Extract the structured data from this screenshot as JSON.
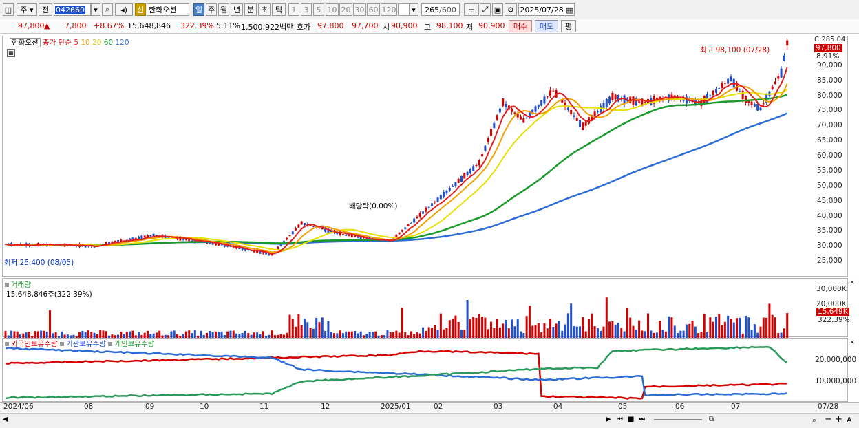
{
  "toolbar": {
    "period": "주",
    "prev_label": "전",
    "code": "042660",
    "stock_name": "한화오션",
    "credit_badge": "신",
    "tabs": [
      "일",
      "주",
      "월",
      "년",
      "분",
      "초",
      "틱"
    ],
    "active_tab": "일",
    "intervals": [
      "1",
      "3",
      "5",
      "10",
      "20",
      "30",
      "60",
      "120"
    ],
    "count": "265",
    "count_max": "/600",
    "date": "2025/07/28"
  },
  "quote": {
    "price": "97,800",
    "arrow": "▲",
    "change": "7,800",
    "change_pct": "+8.67%",
    "volume": "15,648,846",
    "volume_ratio": "322.39%",
    "turnover": "5.11%",
    "amount": "1,500,922백만",
    "hoga_label": "호가",
    "ask": "97,800",
    "bid": "97,700",
    "open_label": "시",
    "open": "90,900",
    "high_label": "고",
    "high": "98,100",
    "low_label": "저",
    "low": "90,900",
    "buy": "매수",
    "sell": "매도",
    "eval": "평"
  },
  "price_panel": {
    "legend_name": "한화오션",
    "ma_label": "종가 단순",
    "ma_periods": [
      {
        "p": "5",
        "color": "#e0201c"
      },
      {
        "p": "10",
        "color": "#f0a000"
      },
      {
        "p": "20",
        "color": "#e8e000"
      },
      {
        "p": "60",
        "color": "#1a9a2a"
      },
      {
        "p": "120",
        "color": "#2c6cd6"
      }
    ],
    "corner_label": "C:285.04",
    "last_price": "97,800",
    "last_pct": "8.91%",
    "high_note": "최고 98,100 (07/28)",
    "low_note": "최저 25,400 (08/05)",
    "dividend_note": "배당락(0.00%)",
    "y_ticks": [
      "90,000",
      "85,000",
      "80,000",
      "75,000",
      "70,000",
      "65,000",
      "60,000",
      "55,000",
      "50,000",
      "45,000",
      "40,000",
      "35,000",
      "30,000",
      "25,000"
    ]
  },
  "volume_panel": {
    "title": "거래량",
    "value": "15,648,846주(322.39%)",
    "y_ticks": [
      "30,000K",
      "20,000K"
    ],
    "last": "15,649K",
    "last_pct": "322.39%"
  },
  "holdings_panel": {
    "legend": [
      "외국인보유수량",
      "기관보유수량",
      "개인보유수량"
    ],
    "y_ticks": [
      "20,000,000",
      "10,000,000"
    ]
  },
  "x_axis": [
    "2024/06",
    "08",
    "09",
    "10",
    "11",
    "12",
    "2025/01",
    "02",
    "03",
    "04",
    "05",
    "06",
    "07"
  ],
  "x_last": "07/28",
  "colors": {
    "up": "#d40000",
    "down": "#1f4fd0",
    "ma5": "#e0201c",
    "ma10": "#f0a000",
    "ma20": "#e8e000",
    "ma60": "#1a9a2a",
    "ma120": "#2c6cd6"
  }
}
